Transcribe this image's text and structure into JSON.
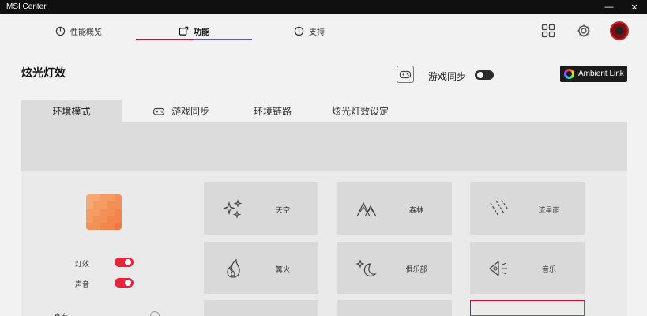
{
  "window": {
    "title": "MSI Center",
    "minimize": "—",
    "close": "✕"
  },
  "nav": {
    "tabs": [
      {
        "label": "性能概览",
        "icon": "gauge-icon"
      },
      {
        "label": "功能",
        "icon": "feature-icon"
      },
      {
        "label": "支持",
        "icon": "support-icon"
      }
    ],
    "active_tab": "功能",
    "accent_red": "#c8102e",
    "accent_blue": "#5b55d6"
  },
  "header": {
    "title": "炫光灯效",
    "game_sync_label": "游戏同步",
    "game_sync_on": false,
    "ambient_link_label": "Ambient Link"
  },
  "subtabs": [
    {
      "label": "环境模式",
      "active": true
    },
    {
      "label": "游戏同步",
      "icon": "gamepad-icon"
    },
    {
      "label": "环境链路"
    },
    {
      "label": "炫光灯效设定"
    }
  ],
  "controls": {
    "lighting_label": "灯效",
    "lighting_on": true,
    "sound_label": "声音",
    "sound_on": true,
    "cut_label": "亮度"
  },
  "cards": [
    {
      "label": "天空",
      "icon": "sparkle-icon"
    },
    {
      "label": "森林",
      "icon": "forest-icon"
    },
    {
      "label": "流星雨",
      "icon": "meteor-icon"
    },
    {
      "label": "篝火",
      "icon": "campfire-icon"
    },
    {
      "label": "俱乐部",
      "icon": "moon-star-icon"
    },
    {
      "label": "音乐",
      "icon": "speaker-icon"
    }
  ],
  "preview_colors": [
    "#f7a774",
    "#f59c63",
    "#f39058",
    "#f1854c",
    "#ef7a40"
  ]
}
